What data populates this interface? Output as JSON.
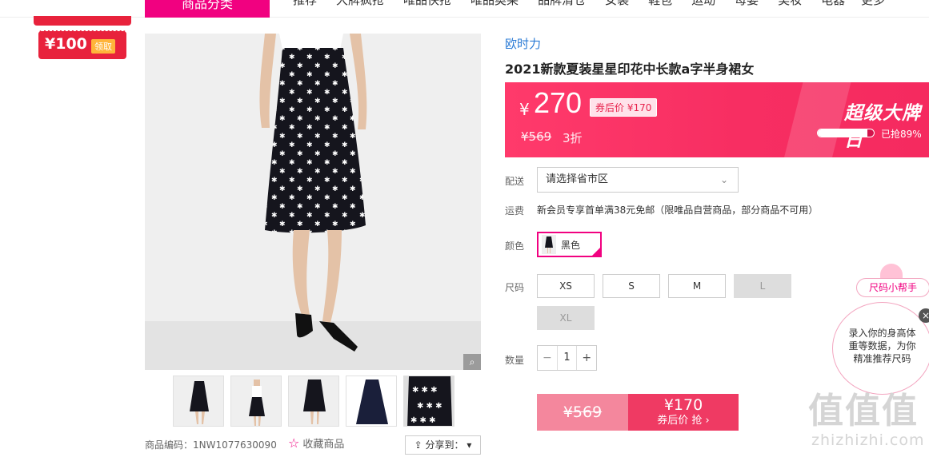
{
  "nav": {
    "category_label": "商品分类",
    "items": [
      "推荐",
      "大牌疯抢",
      "唯品快抢",
      "唯品奥莱",
      "品牌清仓",
      "女装",
      "鞋包",
      "运动",
      "母婴",
      "美妆",
      "电器"
    ],
    "more_label": "更多 ˅"
  },
  "coupon": {
    "amount": "¥100",
    "claim_label": "领取"
  },
  "gallery": {
    "thumbnail_count": 5,
    "product_code": "商品编码：1NW1077630090",
    "favorite_label": "收藏商品",
    "share_label": "分享到："
  },
  "product": {
    "brand": "欧时力",
    "title": "2021新款夏装星星印花中长款a字半身裙女"
  },
  "price": {
    "currency": "¥",
    "current": "270",
    "after_coupon": "券后价 ¥170",
    "original": "¥569",
    "discount": "3折",
    "promo_title": "超级大牌日",
    "sold_fraction": 0.89,
    "sold_text": "已抢89%"
  },
  "delivery": {
    "label": "配送",
    "placeholder": "请选择省市区"
  },
  "shipping": {
    "label": "运费",
    "text": "新会员专享首单满38元免邮（限唯品自营商品，部分商品不可用）"
  },
  "color": {
    "label": "颜色",
    "options": [
      {
        "name": "黑色",
        "selected": true
      }
    ]
  },
  "size": {
    "label": "尺码",
    "options": [
      {
        "name": "XS",
        "available": true
      },
      {
        "name": "S",
        "available": true
      },
      {
        "name": "M",
        "available": true
      },
      {
        "name": "L",
        "available": false
      },
      {
        "name": "XL",
        "available": false
      }
    ]
  },
  "quantity": {
    "label": "数量",
    "value": "1",
    "minus": "−",
    "plus": "+"
  },
  "buy": {
    "original": "¥569",
    "price": "¥170",
    "cta": "券后价 抢 ›"
  },
  "size_helper": {
    "tab_label": "尺码小帮手",
    "bubble_text": "录入你的身高体重等数据，为你精准推荐尺码",
    "close": "×"
  },
  "watermark": {
    "big": "值值值",
    "small": "zhizhizhi.com"
  },
  "colors": {
    "accent": "#f10180",
    "price_banner": "#f72e62",
    "brand_link": "#2b7bd5"
  }
}
